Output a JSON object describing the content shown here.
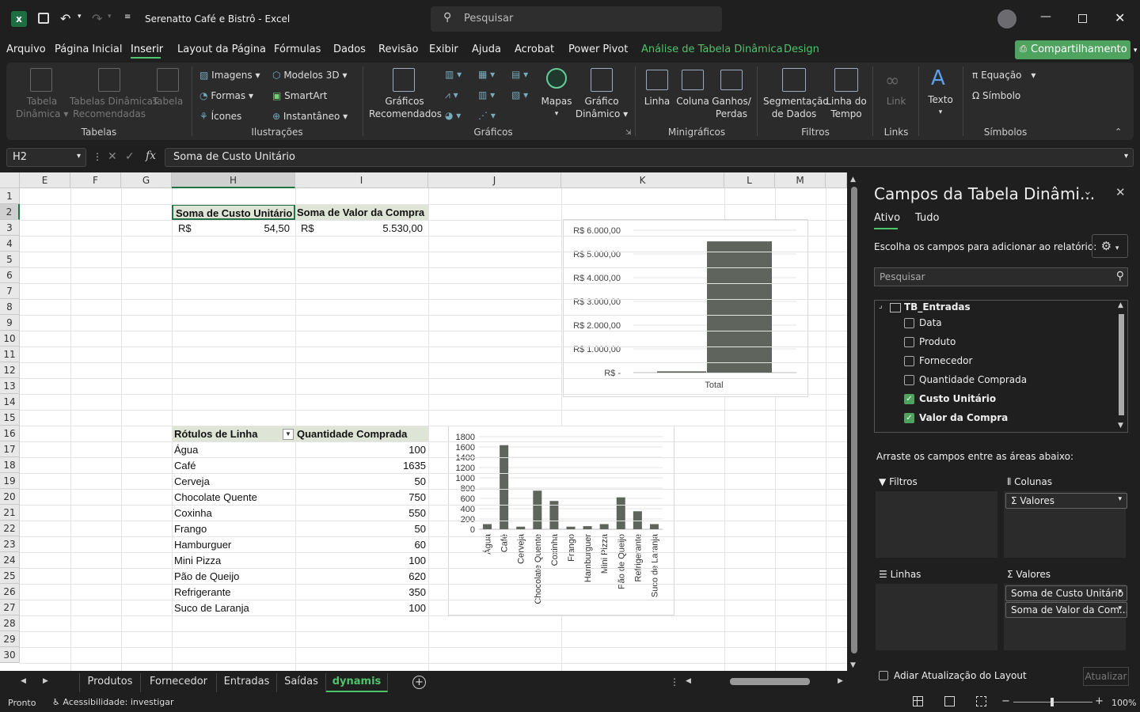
{
  "app": {
    "title": "Serenatto Café e Bistrô",
    "separator": "-",
    "app_name": "Excel",
    "search_placeholder": "Pesquisar"
  },
  "menu": [
    "Arquivo",
    "Página Inicial",
    "Inserir",
    "Layout da Página",
    "Fórmulas",
    "Dados",
    "Revisão",
    "Exibir",
    "Ajuda",
    "Acrobat",
    "Power Pivot",
    "Análise de Tabela Dinâmica",
    "Design"
  ],
  "share_label": "Compartilhamento",
  "ribbon": {
    "tabela_dinamica": [
      "Tabela",
      "Dinâmica"
    ],
    "tabelas_recomendadas": [
      "Tabelas Dinâmicas",
      "Recomendadas"
    ],
    "tabela": "Tabela",
    "group_tabelas": "Tabelas",
    "imagens": "Imagens",
    "formas": "Formas",
    "icones": "Ícones",
    "modelos3d": "Modelos 3D",
    "smartart": "SmartArt",
    "instantaneo": "Instantâneo",
    "group_ilustracoes": "Ilustrações",
    "graficos_recomendados": [
      "Gráficos",
      "Recomendados"
    ],
    "mapas": "Mapas",
    "grafico_dinamico": [
      "Gráfico",
      "Dinâmico"
    ],
    "group_graficos": "Gráficos",
    "linha": "Linha",
    "coluna": "Coluna",
    "ganhos_perdas": [
      "Ganhos/",
      "Perdas"
    ],
    "group_minigraficos": "Minigráficos",
    "segmentacao": [
      "Segmentação",
      "de Dados"
    ],
    "linha_tempo": [
      "Linha do",
      "Tempo"
    ],
    "group_filtros": "Filtros",
    "link": "Link",
    "group_links": "Links",
    "texto": "Texto",
    "equacao": "Equação",
    "simbolo": "Símbolo",
    "group_simbolos": "Símbolos"
  },
  "formula": {
    "cell_ref": "H2",
    "content": "Soma de Custo Unitário",
    "fx": "fx"
  },
  "columns": [
    "E",
    "F",
    "G",
    "H",
    "I",
    "J",
    "K",
    "L",
    "M"
  ],
  "rows": [
    "1",
    "2",
    "3",
    "4",
    "5",
    "6",
    "7",
    "8",
    "9",
    "10",
    "11",
    "12",
    "13",
    "14",
    "15",
    "16",
    "17",
    "18",
    "19",
    "20",
    "21",
    "22",
    "23",
    "24",
    "25",
    "26",
    "27",
    "28",
    "29",
    "30"
  ],
  "pivot1": {
    "h_header": "Soma de Custo Unitário",
    "i_header": "Soma de Valor da Compra",
    "h_currency": "R$",
    "h_value": "54,50",
    "i_currency": "R$",
    "i_value": "5.530,00"
  },
  "pivot2": {
    "row_label_header": "Rótulos de Linha",
    "value_header": "Quantidade Comprada",
    "items": [
      {
        "label": "Água",
        "value": "100"
      },
      {
        "label": "Café",
        "value": "1635"
      },
      {
        "label": "Cerveja",
        "value": "50"
      },
      {
        "label": "Chocolate Quente",
        "value": "750"
      },
      {
        "label": "Coxinha",
        "value": "550"
      },
      {
        "label": "Frango",
        "value": "50"
      },
      {
        "label": "Hamburguer",
        "value": "60"
      },
      {
        "label": "Mini Pizza",
        "value": "100"
      },
      {
        "label": "Pão de Queijo",
        "value": "620"
      },
      {
        "label": "Refrigerante",
        "value": "350"
      },
      {
        "label": "Suco de Laranja",
        "value": "100"
      }
    ]
  },
  "chart_data": [
    {
      "type": "bar",
      "categories": [
        "Total"
      ],
      "series": [
        {
          "values": [
            54.5
          ]
        },
        {
          "values": [
            5530
          ]
        }
      ],
      "y_ticks": [
        "R$ 6.000,00",
        "R$ 5.000,00",
        "R$ 4.000,00",
        "R$ 3.000,00",
        "R$ 2.000,00",
        "R$ 1.000,00",
        "R$ -"
      ],
      "ylim": [
        0,
        6000
      ],
      "grid": true,
      "bar_color": "#5f655c"
    },
    {
      "type": "bar",
      "categories": [
        "Água",
        "Café",
        "Cerveja",
        "Chocolate Quente",
        "Coxinha",
        "Frango",
        "Hamburguer",
        "Mini Pizza",
        "Pão de Queijo",
        "Refrigerante",
        "Suco de Laranja"
      ],
      "values": [
        100,
        1635,
        50,
        750,
        550,
        50,
        60,
        100,
        620,
        350,
        100
      ],
      "y_ticks": [
        "1800",
        "1600",
        "1400",
        "1200",
        "1000",
        "800",
        "600",
        "400",
        "200",
        "0"
      ],
      "ylim": [
        0,
        1800
      ],
      "grid": true,
      "bar_color": "#5f655c"
    }
  ],
  "panel": {
    "title": "Campos da Tabela Dinâmi...",
    "tab_active": "Ativo",
    "tab_all": "Tudo",
    "choose_label": "Escolha os campos para adicionar ao relatório:",
    "search_placeholder": "Pesquisar",
    "table_name": "TB_Entradas",
    "fields": [
      {
        "label": "Data",
        "checked": false
      },
      {
        "label": "Produto",
        "checked": false
      },
      {
        "label": "Fornecedor",
        "checked": false
      },
      {
        "label": "Quantidade Comprada",
        "checked": false
      },
      {
        "label": "Custo Unitário",
        "checked": true
      },
      {
        "label": "Valor da Compra",
        "checked": true
      }
    ],
    "drag_label": "Arraste os campos entre as áreas abaixo:",
    "filtros": "Filtros",
    "colunas": "Colunas",
    "linhas": "Linhas",
    "valores": "Valores",
    "col_pill": "Valores",
    "val_pills": [
      "Soma de Custo Unitário",
      "Soma de Valor da Com..."
    ],
    "defer_label": "Adiar Atualização do Layout",
    "update_btn": "Atualizar"
  },
  "sheets": [
    "Produtos",
    "Fornecedor",
    "Entradas",
    "Saídas",
    "dynamis"
  ],
  "status": {
    "ready": "Pronto",
    "accessibility": "Acessibilidade: investigar",
    "zoom": "100%"
  }
}
